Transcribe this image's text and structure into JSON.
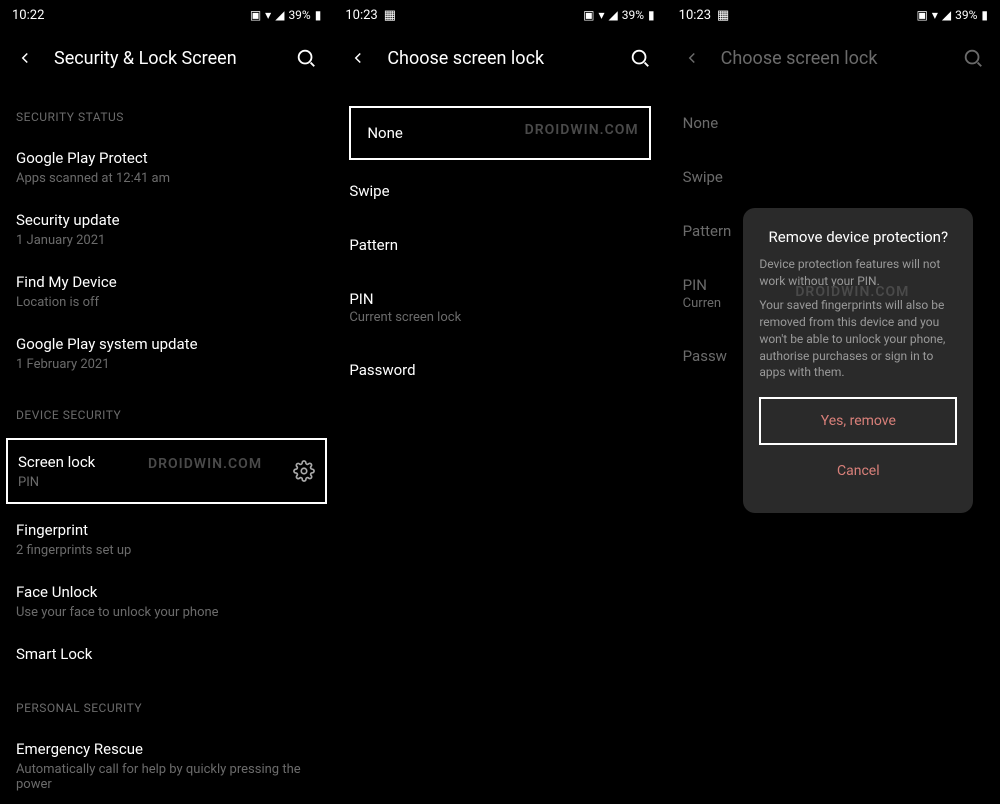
{
  "screen1": {
    "time": "10:22",
    "battery": "39%",
    "title": "Security & Lock Screen",
    "sections": {
      "security_status": {
        "header": "SECURITY STATUS",
        "items": [
          {
            "title": "Google Play Protect",
            "subtitle": "Apps scanned at 12:41 am"
          },
          {
            "title": "Security update",
            "subtitle": "1 January 2021"
          },
          {
            "title": "Find My Device",
            "subtitle": "Location is off"
          },
          {
            "title": "Google Play system update",
            "subtitle": "1 February 2021"
          }
        ]
      },
      "device_security": {
        "header": "DEVICE SECURITY",
        "screen_lock": {
          "title": "Screen lock",
          "subtitle": "PIN"
        },
        "items": [
          {
            "title": "Fingerprint",
            "subtitle": "2 fingerprints set up"
          },
          {
            "title": "Face Unlock",
            "subtitle": "Use your face to unlock your phone"
          },
          {
            "title": "Smart Lock",
            "subtitle": ""
          }
        ]
      },
      "personal_security": {
        "header": "PERSONAL SECURITY",
        "items": [
          {
            "title": "Emergency Rescue",
            "subtitle": "Automatically call for help by quickly pressing the power"
          }
        ]
      }
    },
    "watermark": "DROIDWIN.COM"
  },
  "screen2": {
    "time": "10:23",
    "battery": "39%",
    "title": "Choose screen lock",
    "options": {
      "none": "None",
      "swipe": "Swipe",
      "pattern": "Pattern",
      "pin": {
        "title": "PIN",
        "subtitle": "Current screen lock"
      },
      "password": "Password"
    },
    "watermark": "DROIDWIN.COM"
  },
  "screen3": {
    "time": "10:23",
    "battery": "39%",
    "title": "Choose screen lock",
    "options": {
      "none": "None",
      "swipe": "Swipe",
      "pattern": "Pattern",
      "pin": {
        "title": "PIN",
        "subtitle": "Curren"
      },
      "password": "Passw"
    },
    "dialog": {
      "title": "Remove device protection?",
      "body1": "Device protection features will not work without your PIN.",
      "body2": "Your saved fingerprints will also be removed from this device and you won't be able to unlock your phone, authorise purchases or sign in to apps with them.",
      "yes": "Yes, remove",
      "cancel": "Cancel"
    },
    "watermark": "DROIDWIN.COM"
  }
}
